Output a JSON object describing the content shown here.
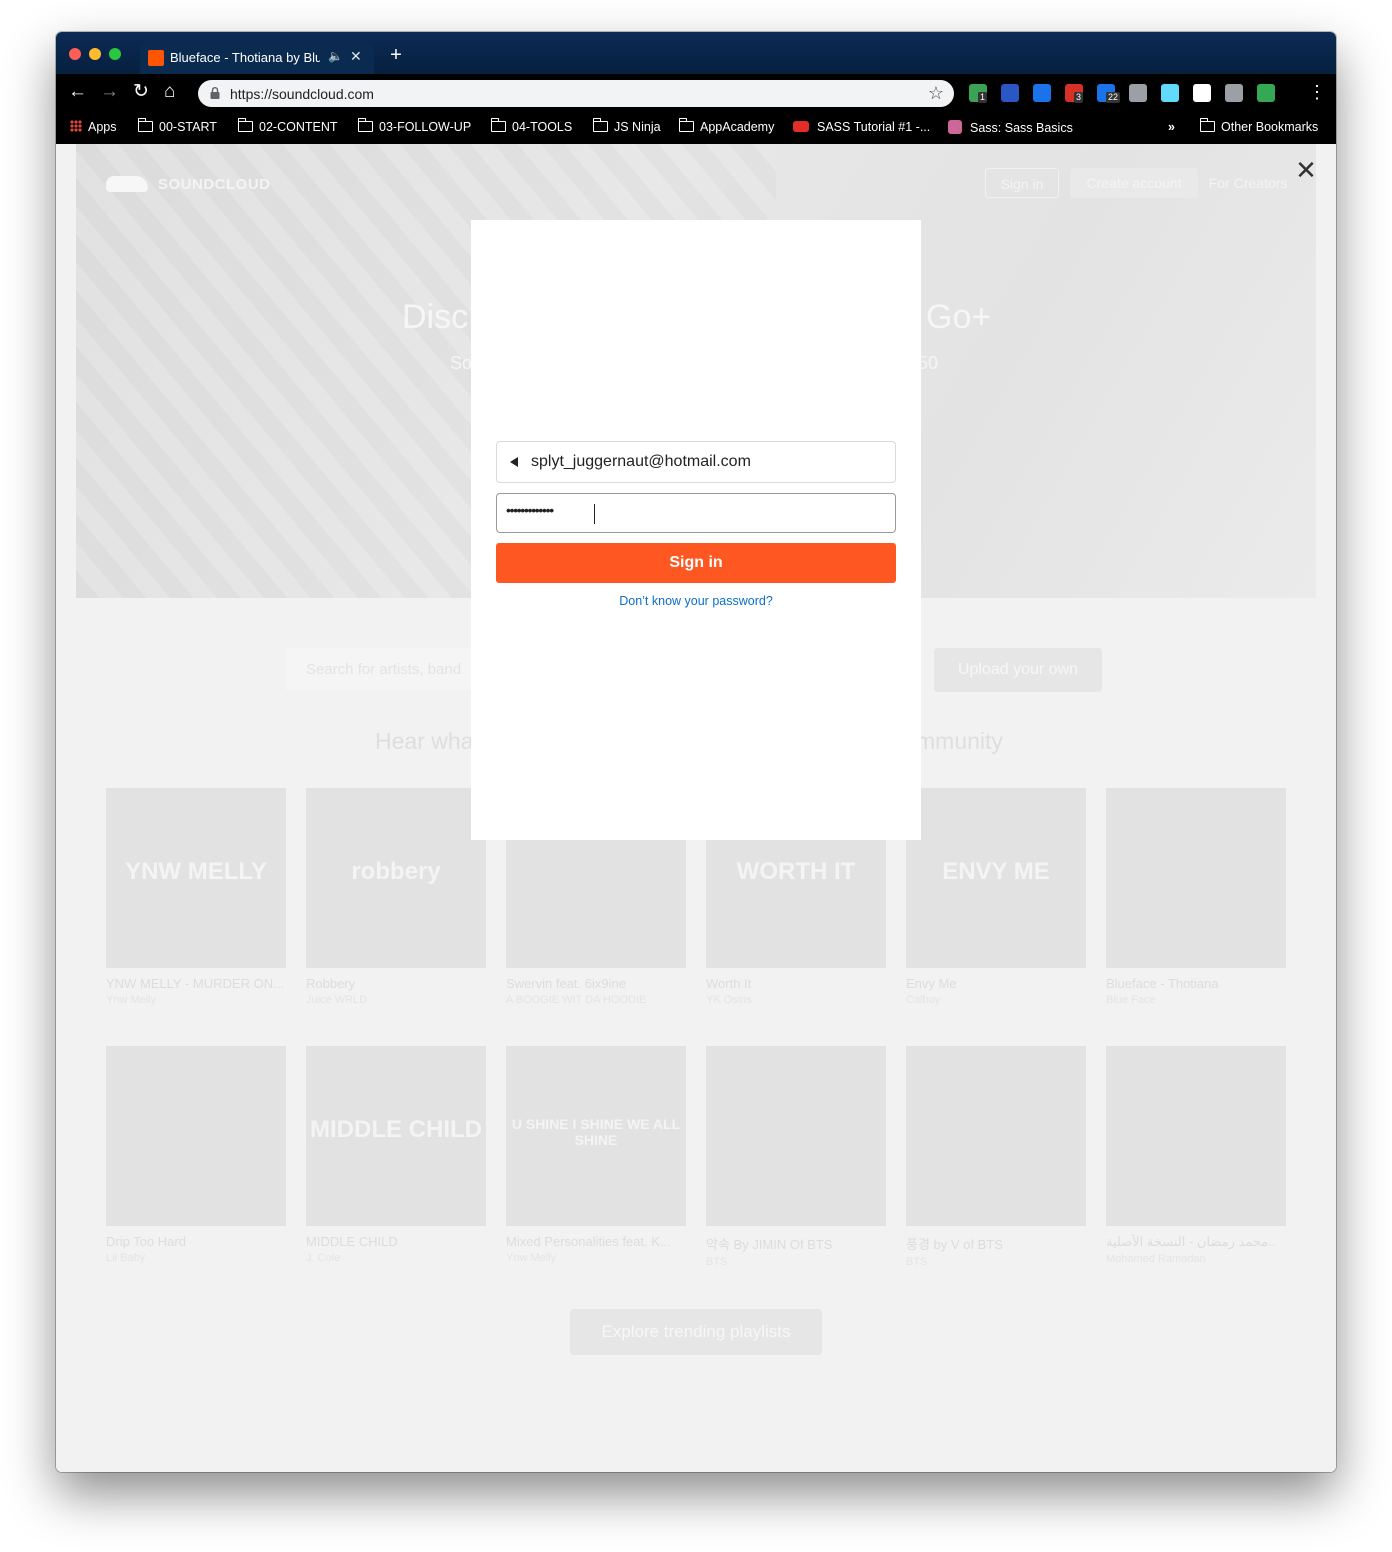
{
  "browser": {
    "tab_title": "Blueface - Thotiana by Blueface",
    "url": "https://soundcloud.com",
    "extensions": [
      {
        "name": "check-ext-icon",
        "badge": "1",
        "color": "#3aa356"
      },
      {
        "name": "flag-ext-icon",
        "badge": "",
        "color": "#2b57c4"
      },
      {
        "name": "grammarly-ext-icon",
        "badge": "",
        "color": "#1a73e8"
      },
      {
        "name": "todo-ext-icon",
        "badge": "3",
        "color": "#d93025"
      },
      {
        "name": "calendar-ext-icon",
        "badge": "22",
        "color": "#1a73e8"
      },
      {
        "name": "bulb-ext-icon",
        "badge": "",
        "color": "#9aa0a6"
      },
      {
        "name": "react-ext-icon",
        "badge": "",
        "color": "#61dafb"
      },
      {
        "name": "target-ext-icon",
        "badge": "",
        "color": "#ffffff"
      },
      {
        "name": "sync-ext-icon",
        "badge": "",
        "color": "#9aa0a6"
      },
      {
        "name": "plant-ext-icon",
        "badge": "",
        "color": "#34a853"
      }
    ],
    "bookmarks": [
      {
        "label": "Apps",
        "icon": "apps-icon"
      },
      {
        "label": "00-START",
        "icon": "folder-icon"
      },
      {
        "label": "02-CONTENT",
        "icon": "folder-icon"
      },
      {
        "label": "03-FOLLOW-UP",
        "icon": "folder-icon"
      },
      {
        "label": "04-TOOLS",
        "icon": "folder-icon"
      },
      {
        "label": "JS Ninja",
        "icon": "folder-icon"
      },
      {
        "label": "AppAcademy",
        "icon": "folder-icon"
      },
      {
        "label": "SASS Tutorial #1 -...",
        "icon": "youtube-icon"
      },
      {
        "label": "Sass: Sass Basics",
        "icon": "sass-icon"
      }
    ],
    "overflow": "»",
    "other_bookmarks": "Other Bookmarks"
  },
  "header": {
    "logo_text": "SOUNDCLOUD",
    "signin_label": "Sign in",
    "create_label": "Create account",
    "creators_label": "For Creators"
  },
  "hero": {
    "title_left": "Disc",
    "title_right": "Go+",
    "sub_left": "So",
    "sub_right": "50"
  },
  "search": {
    "placeholder": "Search for artists, band",
    "upload_label": "Upload your own"
  },
  "section": {
    "heading_left": "Hear wha",
    "heading_right": "mmunity"
  },
  "tracks_row1": [
    {
      "title": "YNW MELLY - MURDER ON...",
      "artist": "Ynw Melly",
      "art": "YNW MELLY"
    },
    {
      "title": "Robbery",
      "artist": "Juice WRLD",
      "art": "robbery"
    },
    {
      "title": "Swervin feat. 6ix9ine",
      "artist": "A BOOGIE WIT DA HOODIE",
      "art": ""
    },
    {
      "title": "Worth It",
      "artist": "YK Osiris",
      "art": "WORTH IT"
    },
    {
      "title": "Envy Me",
      "artist": "Calboy",
      "art": "ENVY ME"
    },
    {
      "title": "Blueface - Thotiana",
      "artist": "Blue Face",
      "art": ""
    }
  ],
  "tracks_row2": [
    {
      "title": "Drip Too Hard",
      "artist": "Lil Baby",
      "art": ""
    },
    {
      "title": "MIDDLE CHILD",
      "artist": "J. Cole",
      "art": "MIDDLE CHILD"
    },
    {
      "title": "Mixed Personalities feat. K...",
      "artist": "Ynw Melly",
      "art": "U SHINE I SHINE WE ALL SHINE"
    },
    {
      "title": "약속 By JIMIN Of BTS",
      "artist": "BTS",
      "art": ""
    },
    {
      "title": "풍경 by V of BTS",
      "artist": "BTS",
      "art": ""
    },
    {
      "title": "محمد رمضان - النسخة الأصلية..",
      "artist": "Mohamed Ramadan",
      "art": ""
    }
  ],
  "explore_label": "Explore trending playlists",
  "modal": {
    "email": "splyt_juggernaut@hotmail.com",
    "password_mask": "•••••••••••••",
    "signin_label": "Sign in",
    "forgot_label": "Don’t know your password?"
  },
  "colors": {
    "accent": "#ff5722",
    "link": "#0b6fc9"
  }
}
